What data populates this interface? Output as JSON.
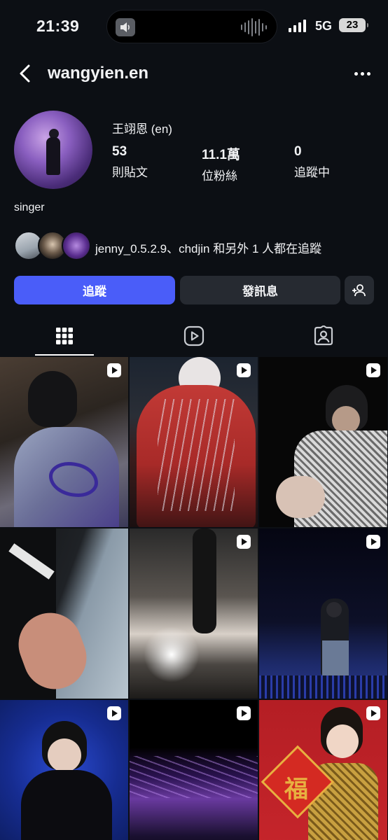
{
  "status_bar": {
    "time": "21:39",
    "network": "5G",
    "battery": "23"
  },
  "header": {
    "username": "wangyien.en",
    "back_icon": "chevron-left-icon",
    "more_icon": "more-horizontal-icon"
  },
  "profile": {
    "display_name": "王翊恩 (en)",
    "stats": [
      {
        "value": "53",
        "label": "則貼文"
      },
      {
        "value": "11.1萬",
        "label": "位粉絲"
      },
      {
        "value": "0",
        "label": "追蹤中"
      }
    ],
    "bio": "singer",
    "mutual_text": "jenny_0.5.2.9、chdjin 和另外 1 人都在追蹤"
  },
  "actions": {
    "follow_label": "追蹤",
    "message_label": "發訊息",
    "add_icon": "add-person-icon",
    "follow_color": "#4a5df9"
  },
  "tabs": [
    {
      "name": "grid",
      "icon": "grid-icon",
      "active": true
    },
    {
      "name": "reels",
      "icon": "reels-icon",
      "active": false
    },
    {
      "name": "tagged",
      "icon": "tagged-icon",
      "active": false
    }
  ],
  "posts": [
    {
      "reel": true
    },
    {
      "reel": true
    },
    {
      "reel": true
    },
    {
      "reel": false
    },
    {
      "reel": true
    },
    {
      "reel": true
    },
    {
      "reel": true
    },
    {
      "reel": true
    },
    {
      "reel": true
    }
  ]
}
